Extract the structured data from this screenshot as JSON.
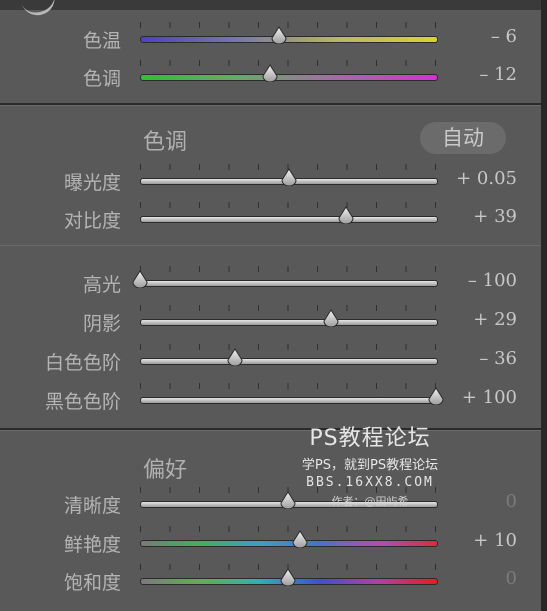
{
  "white_balance": {
    "sliders": [
      {
        "id": "temp",
        "label": "色温",
        "value_text": "– 6",
        "fraction": 0.47,
        "colors": [
          "#5040c8",
          "#7a78a6",
          "#b8b860",
          "#d8d238"
        ]
      },
      {
        "id": "tint",
        "label": "色调",
        "value_text": "– 12",
        "fraction": 0.44,
        "colors": [
          "#2fc02f",
          "#6aa86a",
          "#a46aa4",
          "#d630d6"
        ]
      }
    ]
  },
  "tone": {
    "title": "色调",
    "auto_label": "自动",
    "sliders": [
      {
        "id": "exposure",
        "label": "曝光度",
        "value_text": "+ 0.05",
        "fraction": 0.505
      },
      {
        "id": "contrast",
        "label": "对比度",
        "value_text": "+ 39",
        "fraction": 0.695
      },
      {
        "id": "highlights",
        "label": "高光",
        "value_text": "– 100",
        "fraction": 0.0
      },
      {
        "id": "shadows",
        "label": "阴影",
        "value_text": "+ 29",
        "fraction": 0.645
      },
      {
        "id": "whites",
        "label": "白色色阶",
        "value_text": "– 36",
        "fraction": 0.32
      },
      {
        "id": "blacks",
        "label": "黑色色阶",
        "value_text": "+ 100",
        "fraction": 1.0
      }
    ]
  },
  "presence": {
    "title": "偏好",
    "sliders": [
      {
        "id": "clarity",
        "label": "清晰度",
        "value_text": "0",
        "fraction": 0.5,
        "dim": true
      },
      {
        "id": "vibrance",
        "label": "鲜艳度",
        "value_text": "+ 10",
        "fraction": 0.54,
        "colors": [
          "#7a7a7a",
          "#3fb060",
          "#3aa0c0",
          "#4a70d0",
          "#b050b0",
          "#d03040"
        ]
      },
      {
        "id": "saturation",
        "label": "饱和度",
        "value_text": "0",
        "fraction": 0.5,
        "dim": true,
        "colors": [
          "#7a7a7a",
          "#5fb050",
          "#30b0b0",
          "#4050d0",
          "#b040a0",
          "#e02020"
        ]
      }
    ]
  },
  "watermark": {
    "title": "PS教程论坛",
    "subtitle": "学PS，就到PS教程论坛",
    "url": "BBS.16XX8.COM",
    "author": "作者：@田屿希"
  }
}
